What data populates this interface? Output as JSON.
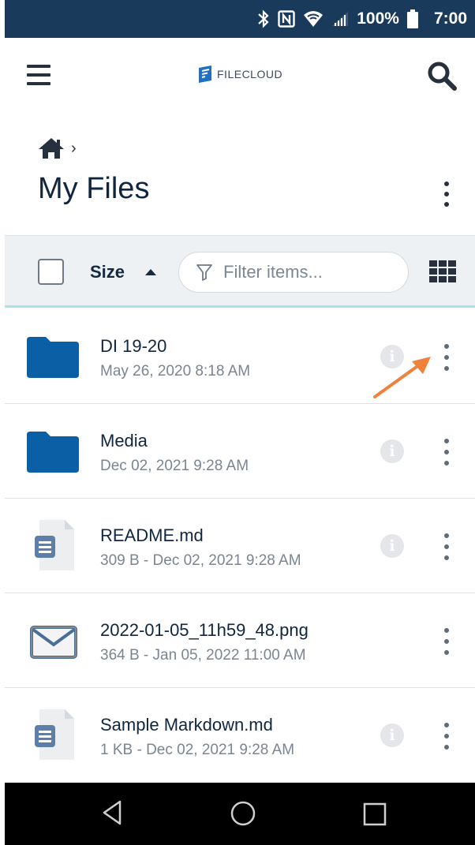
{
  "status_bar": {
    "battery_text": "100%",
    "time": "7:00",
    "icons": [
      "bluetooth-icon",
      "nfc-icon",
      "wifi-icon",
      "signal-icon",
      "battery-icon"
    ]
  },
  "header": {
    "logo_text": "FILECLOUD",
    "menu_icon": "hamburger-icon",
    "search_icon": "search-icon"
  },
  "breadcrumb": {
    "home_icon": "home-icon",
    "separator": "›"
  },
  "page": {
    "title": "My Files"
  },
  "toolbar": {
    "sort_label": "Size",
    "sort_direction": "ascending",
    "filter_placeholder": "Filter items...",
    "filter_value": "",
    "view_icon": "grid-view-icon"
  },
  "files": [
    {
      "name": "DI 19-20",
      "meta": "May 26, 2020 8:18 AM",
      "type": "folder"
    },
    {
      "name": "Media",
      "meta": "Dec 02, 2021 9:28 AM",
      "type": "folder"
    },
    {
      "name": "README.md",
      "meta": "309 B - Dec 02, 2021 9:28 AM",
      "type": "document"
    },
    {
      "name": "2022-01-05_11h59_48.png",
      "meta": "364 B - Jan 05, 2022 11:00 AM",
      "type": "image"
    },
    {
      "name": "Sample Markdown.md",
      "meta": "1 KB - Dec 02, 2021 9:28 AM",
      "type": "document"
    }
  ],
  "colors": {
    "status_bar": "#1a3a5c",
    "folder": "#0b5fa5",
    "accent_line": "#a8e3ea",
    "annotation_arrow": "#f0813a",
    "nav_bar": "#000000"
  }
}
